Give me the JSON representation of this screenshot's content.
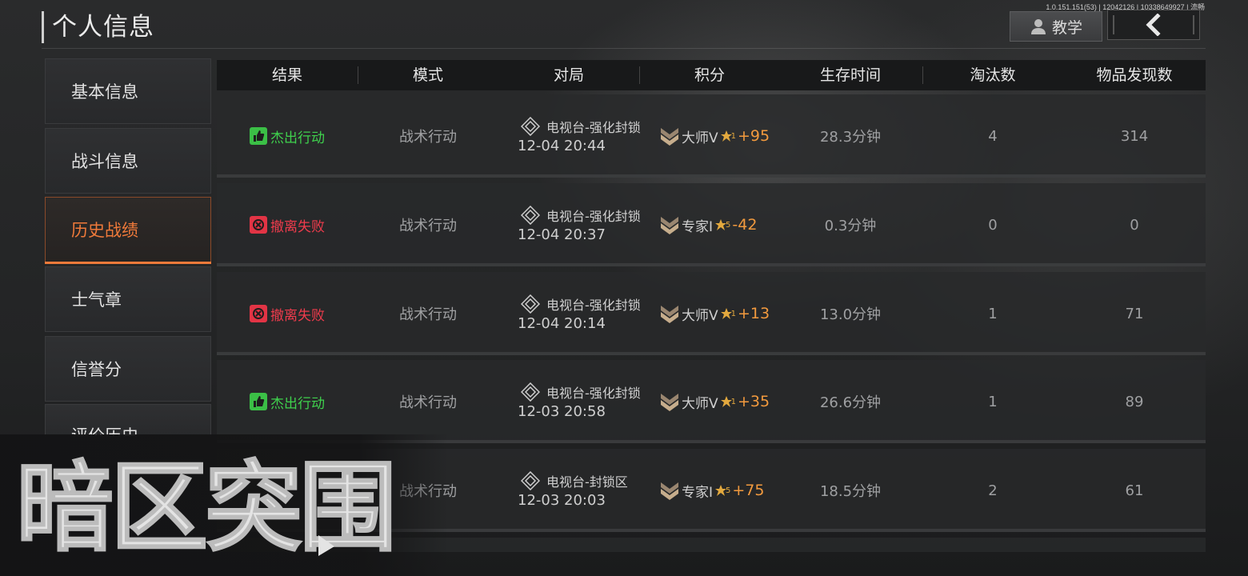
{
  "header": {
    "title": "个人信息",
    "build_info": "1.0.151.151(53) | 12042126 | 10338649927 | 流畅",
    "tutorial_label": "教学"
  },
  "sidebar": {
    "items": [
      {
        "label": "基本信息"
      },
      {
        "label": "战斗信息"
      },
      {
        "label": "历史战绩",
        "active": true
      },
      {
        "label": "士气章"
      },
      {
        "label": "信誉分"
      },
      {
        "label": "评价历史"
      }
    ]
  },
  "table": {
    "columns": [
      "结果",
      "模式",
      "对局",
      "积分",
      "生存时间",
      "淘汰数",
      "物品发现数"
    ],
    "rows": [
      {
        "result": "杰出行动",
        "result_type": "win",
        "mode": "战术行动",
        "map": "电视台-强化封锁",
        "time": "12-04 20:44",
        "rank": "大师V",
        "stars": "1",
        "delta": "+95",
        "survival": "28.3分钟",
        "kills": "4",
        "items": "314"
      },
      {
        "result": "撤离失败",
        "result_type": "fail",
        "mode": "战术行动",
        "map": "电视台-强化封锁",
        "time": "12-04 20:37",
        "rank": "专家I",
        "stars": "5",
        "delta": "-42",
        "survival": "0.3分钟",
        "kills": "0",
        "items": "0"
      },
      {
        "result": "撤离失败",
        "result_type": "fail",
        "mode": "战术行动",
        "map": "电视台-强化封锁",
        "time": "12-04 20:14",
        "rank": "大师V",
        "stars": "1",
        "delta": "+13",
        "survival": "13.0分钟",
        "kills": "1",
        "items": "71"
      },
      {
        "result": "杰出行动",
        "result_type": "win",
        "mode": "战术行动",
        "map": "电视台-强化封锁",
        "time": "12-03 20:58",
        "rank": "大师V",
        "stars": "1",
        "delta": "+35",
        "survival": "26.6分钟",
        "kills": "1",
        "items": "89"
      },
      {
        "result": "",
        "result_type": "hidden",
        "mode": "战术行动",
        "map": "电视台-封锁区",
        "time": "12-03 20:03",
        "rank": "专家I",
        "stars": "5",
        "delta": "+75",
        "survival": "18.5分钟",
        "kills": "2",
        "items": "61"
      }
    ]
  },
  "logo": {
    "text": "暗区突围"
  },
  "colors": {
    "accent": "#f07a3a",
    "win": "#3fd14d",
    "fail": "#ef3b4c",
    "delta": "#f29a3e"
  }
}
